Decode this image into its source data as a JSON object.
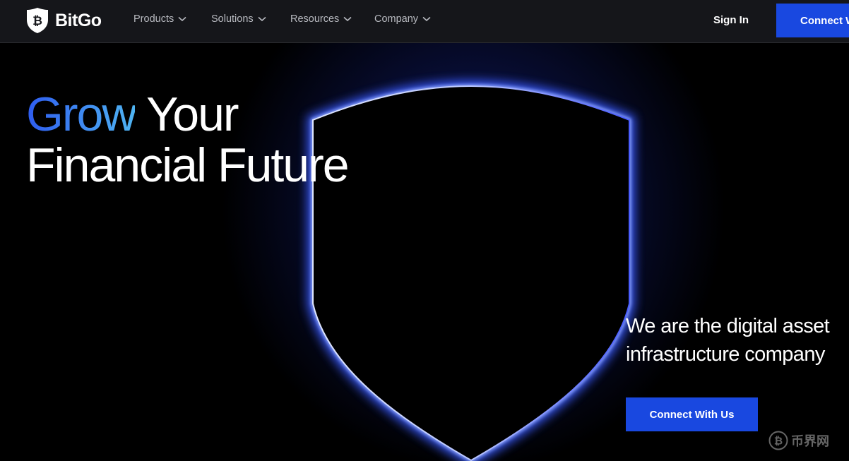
{
  "brand": {
    "name": "BitGo"
  },
  "nav": {
    "items": [
      {
        "label": "Products"
      },
      {
        "label": "Solutions"
      },
      {
        "label": "Resources"
      },
      {
        "label": "Company"
      }
    ],
    "sign_in": "Sign In",
    "connect": "Connect With Us"
  },
  "hero": {
    "headline_accent": "Grow",
    "headline_rest": " Your",
    "headline_line2": "Financial Future",
    "subtitle_line1": "We are the digital asset",
    "subtitle_line2": "infrastructure company",
    "cta": "Connect With Us"
  },
  "watermark": {
    "text": "币界网"
  },
  "colors": {
    "accent": "#1948e0",
    "nav_bg": "#15161a",
    "page_bg": "#000000",
    "glow": "#2846ff",
    "grow_gradient_start": "#2e5cf0",
    "grow_gradient_end": "#4fb4f2"
  }
}
